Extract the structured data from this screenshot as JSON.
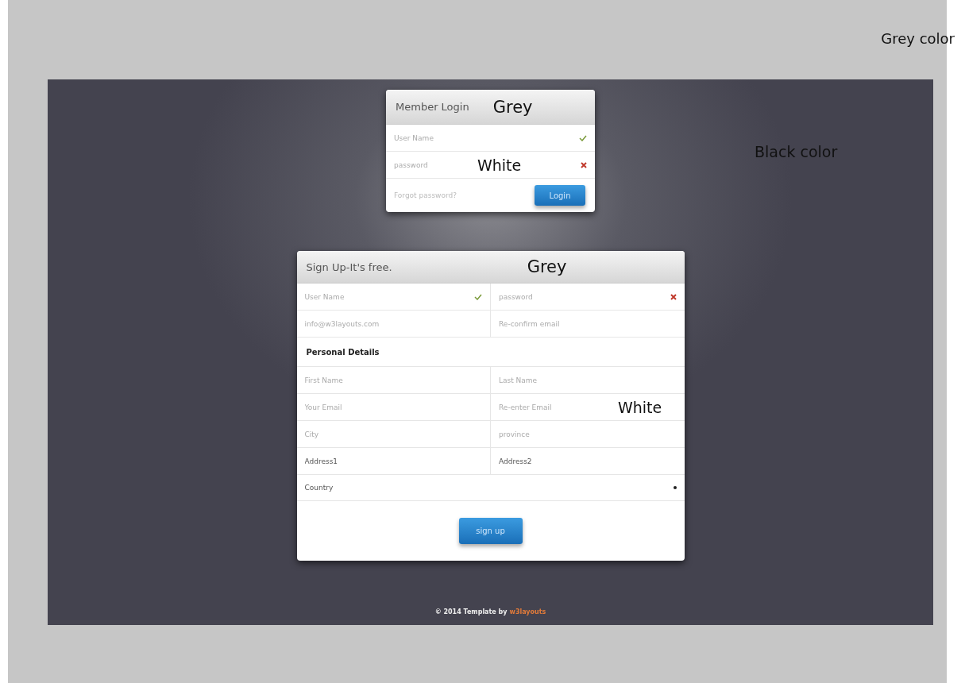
{
  "outer_note": "Grey color",
  "page_note": "Black color",
  "login": {
    "title": "Member Login",
    "header_note": "Grey",
    "fields": [
      {
        "placeholder": "User Name",
        "valid": true
      },
      {
        "placeholder": "password",
        "valid": false,
        "note": "White"
      }
    ],
    "forgot_link": "Forgot password?",
    "button": "Login"
  },
  "signup": {
    "title": "Sign Up-It's free.",
    "header_note": "Grey",
    "rows": [
      {
        "kind": "pair",
        "fields": [
          {
            "placeholder": "User Name",
            "valid": true
          },
          {
            "placeholder": "password",
            "valid": false
          }
        ]
      },
      {
        "kind": "pair",
        "fields": [
          {
            "placeholder": "info@w3layouts.com"
          },
          {
            "placeholder": "Re-confirm email"
          }
        ]
      },
      {
        "kind": "heading",
        "text": "Personal Details"
      },
      {
        "kind": "pair",
        "fields": [
          {
            "placeholder": "First Name"
          },
          {
            "placeholder": "Last Name"
          }
        ]
      },
      {
        "kind": "pair",
        "fields": [
          {
            "placeholder": "Your Email"
          },
          {
            "placeholder": "Re-enter Email",
            "note": "White"
          }
        ]
      },
      {
        "kind": "pair",
        "fields": [
          {
            "placeholder": "City"
          },
          {
            "placeholder": "province"
          }
        ]
      },
      {
        "kind": "pair",
        "fields": [
          {
            "value": "Address1"
          },
          {
            "value": "Address2"
          }
        ]
      },
      {
        "kind": "select",
        "fields": [
          {
            "value": "Country"
          }
        ]
      }
    ],
    "button": "sign up"
  },
  "footer": {
    "text": "© 2014 Template by",
    "link": "w3layouts"
  }
}
